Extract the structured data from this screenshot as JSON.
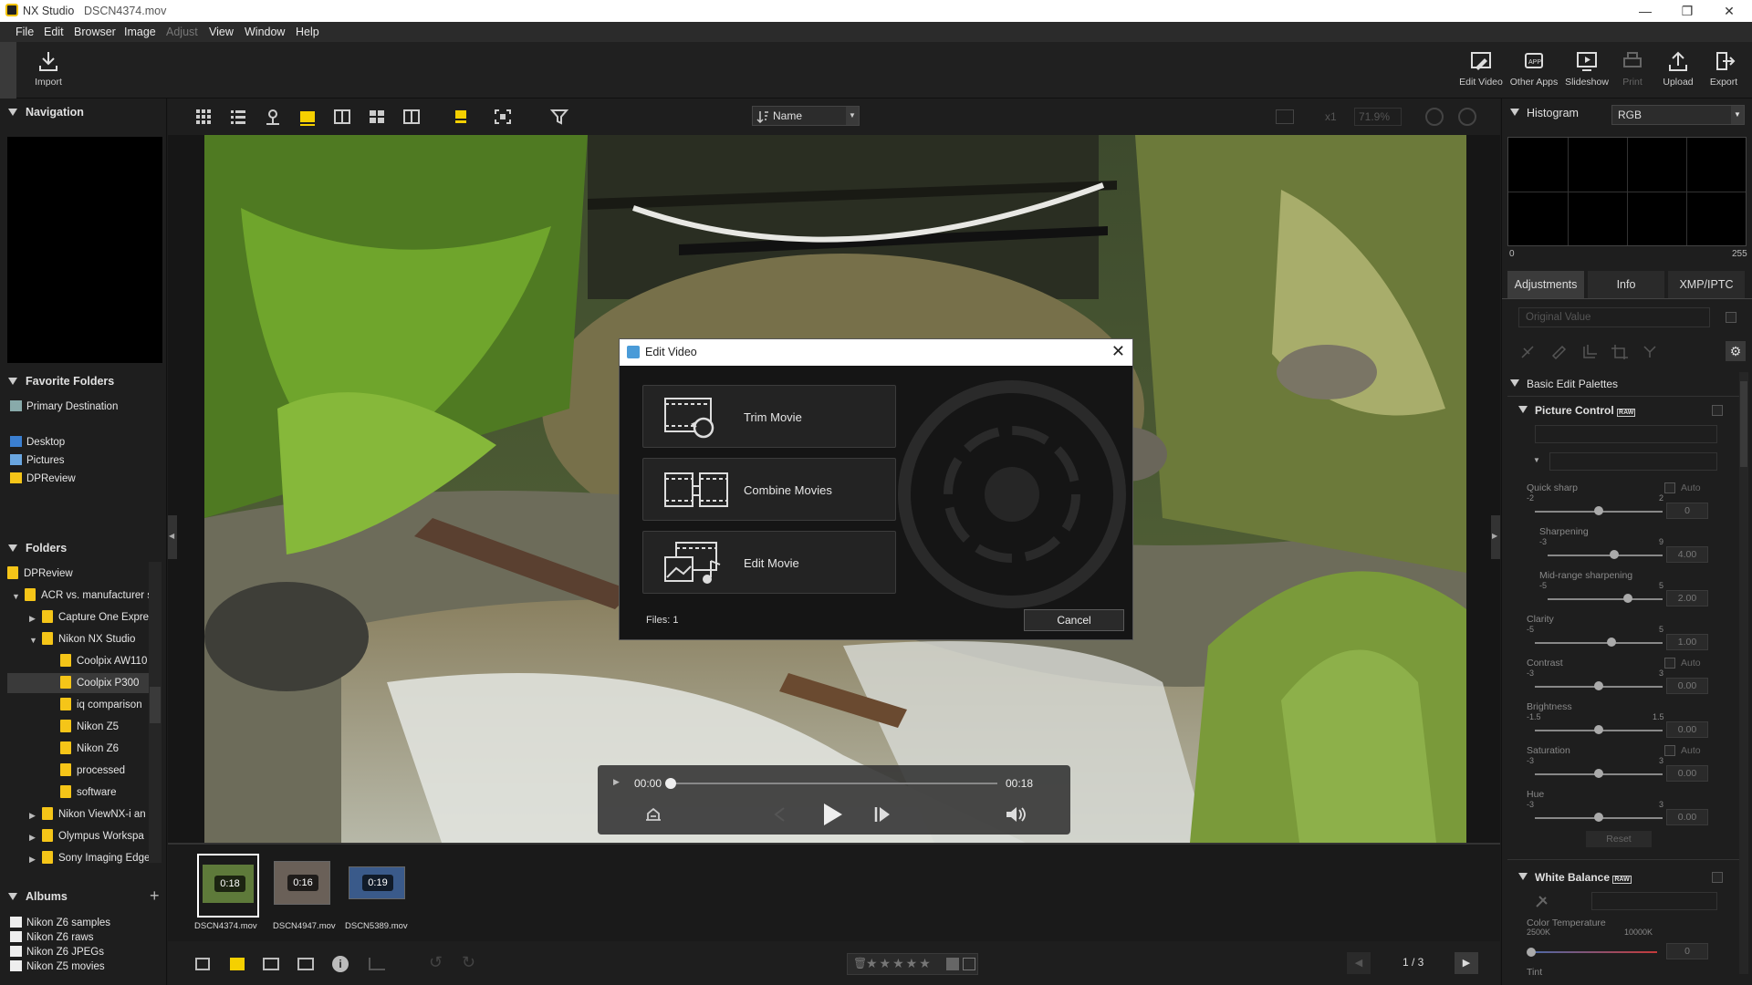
{
  "titlebar": {
    "app": "NX Studio",
    "file": "DSCN4374.mov"
  },
  "menu": [
    "File",
    "Edit",
    "Browser",
    "Image",
    "Adjust",
    "View",
    "Window",
    "Help"
  ],
  "toolbar": {
    "import": "Import",
    "right": [
      "Edit Video",
      "Other Apps",
      "Slideshow",
      "Print",
      "Upload",
      "Export"
    ]
  },
  "navigation": {
    "title": "Navigation"
  },
  "favorites": {
    "title": "Favorite Folders",
    "items": [
      "Primary Destination",
      "Desktop",
      "Pictures",
      "DPReview"
    ]
  },
  "folders": {
    "title": "Folders",
    "items": [
      "DPReview",
      "ACR vs. manufacturer s",
      "Capture One Expre",
      "Nikon NX Studio",
      "Coolpix AW110",
      "Coolpix P300",
      "iq comparison",
      "Nikon Z5",
      "Nikon Z6",
      "processed",
      "software",
      "Nikon ViewNX-i an",
      "Olympus Workspa",
      "Sony Imaging Edge"
    ]
  },
  "albums": {
    "title": "Albums",
    "items": [
      "Nikon Z6 samples",
      "Nikon Z6 raws",
      "Nikon Z6 JPEGs",
      "Nikon Z5 movies"
    ]
  },
  "viewer_toolbar": {
    "sort": "Name",
    "zoom_mult": "x1",
    "zoom_pct": "71.9%"
  },
  "dialog": {
    "title": "Edit Video",
    "options": [
      "Trim Movie",
      "Combine Movies",
      "Edit Movie"
    ],
    "files": "Files: 1",
    "cancel": "Cancel"
  },
  "player": {
    "current": "00:00",
    "total": "00:18",
    "progress": 0.0
  },
  "filmstrip": [
    {
      "name": "DSCN4374.mov",
      "duration": "0:18"
    },
    {
      "name": "DSCN4947.mov",
      "duration": "0:16"
    },
    {
      "name": "DSCN5389.mov",
      "duration": "0:19"
    }
  ],
  "pager": "1 / 3",
  "right": {
    "histogram": "Histogram",
    "channel": "RGB",
    "histo_min": "0",
    "histo_max": "255",
    "tabs": [
      "Adjustments",
      "Info",
      "XMP/IPTC"
    ],
    "original": "Original Value",
    "basic": "Basic Edit Palettes",
    "picture_control": "Picture Control",
    "raw_badge": "RAW",
    "auto": "Auto",
    "reset": "Reset",
    "white_balance": "White Balance",
    "color_temp": "Color Temperature",
    "temp_min": "2500K",
    "temp_max": "10000K",
    "temp_val": "0",
    "tint": "Tint",
    "sliders": [
      {
        "label": "Quick sharp",
        "min": "-2",
        "max": "2",
        "value": "0",
        "pos": 0.5
      },
      {
        "label": "Sharpening",
        "min": "-3",
        "max": "9",
        "value": "4.00",
        "pos": 0.58
      },
      {
        "label": "Mid-range sharpening",
        "min": "-5",
        "max": "5",
        "value": "2.00",
        "pos": 0.7
      },
      {
        "label": "Clarity",
        "min": "-5",
        "max": "5",
        "value": "1.00",
        "pos": 0.6
      },
      {
        "label": "Contrast",
        "min": "-3",
        "max": "3",
        "value": "0.00",
        "pos": 0.5
      },
      {
        "label": "Brightness",
        "min": "-1.5",
        "max": "1.5",
        "value": "0.00",
        "pos": 0.5
      },
      {
        "label": "Saturation",
        "min": "-3",
        "max": "3",
        "value": "0.00",
        "pos": 0.5
      },
      {
        "label": "Hue",
        "min": "-3",
        "max": "3",
        "value": "0.00",
        "pos": 0.5
      }
    ]
  }
}
